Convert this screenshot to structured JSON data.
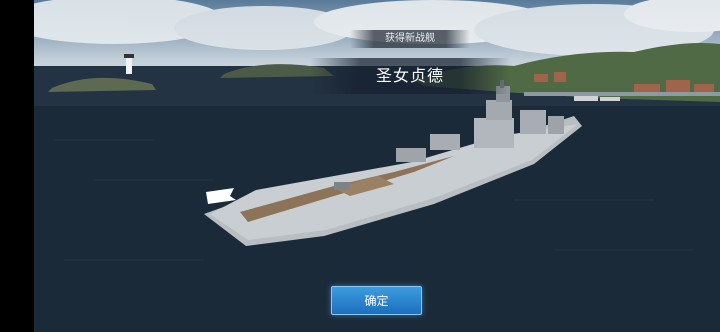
{
  "banner": {
    "subtitle": "获得新战舰",
    "ship_name": "圣女贞德"
  },
  "actions": {
    "confirm_label": "确定"
  },
  "colors": {
    "button_accent": "#2a86d2",
    "sea": "#12202e"
  }
}
